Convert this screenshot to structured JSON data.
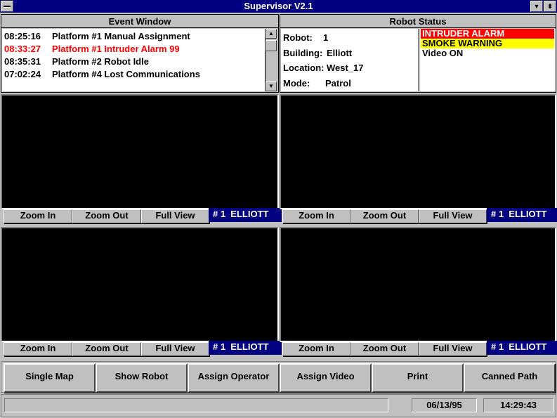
{
  "window": {
    "title": "Supervisor V2.1"
  },
  "event_window": {
    "title": "Event Window",
    "events": [
      {
        "time": "08:25:16",
        "text": "Platform #1 Manual Assignment",
        "color": "#000000"
      },
      {
        "time": "08:33:27",
        "text": "Platform #1 Intruder Alarm 99",
        "color": "#ff0000"
      },
      {
        "time": "08:35:31",
        "text": "Platform #2 Robot Idle",
        "color": "#000000"
      },
      {
        "time": "07:02:24",
        "text": "Platform #4  Lost Communications",
        "color": "#000000"
      }
    ]
  },
  "robot_status": {
    "title": "Robot Status",
    "robot_label": "Robot:",
    "robot_value": "1",
    "building_label": "Building:",
    "building_value": "Elliott",
    "location_label": "Location:",
    "location_value": "West_17",
    "mode_label": "Mode:",
    "mode_value": "Patrol",
    "alarms": [
      {
        "text": "INTRUDER ALARM",
        "bg": "#ff0000",
        "fg": "#ffffff"
      },
      {
        "text": "SMOKE WARNING",
        "bg": "#ffff00",
        "fg": "#000000"
      },
      {
        "text": "Video ON",
        "bg": "#ffffff",
        "fg": "#000000"
      }
    ]
  },
  "video_panels": [
    {
      "zoom_in": "Zoom In",
      "zoom_out": "Zoom Out",
      "full_view": "Full View",
      "label": "# 1  ELLIOTT"
    },
    {
      "zoom_in": "Zoom In",
      "zoom_out": "Zoom Out",
      "full_view": "Full View",
      "label": "# 1  ELLIOTT"
    },
    {
      "zoom_in": "Zoom In",
      "zoom_out": "Zoom Out",
      "full_view": "Full View",
      "label": "# 1  ELLIOTT"
    },
    {
      "zoom_in": "Zoom In",
      "zoom_out": "Zoom Out",
      "full_view": "Full View",
      "label": "# 1  ELLIOTT"
    }
  ],
  "toolbar": {
    "single_map": "Single Map",
    "show_robot": "Show Robot",
    "assign_operator": "Assign Operator",
    "assign_video": "Assign Video",
    "print": "Print",
    "canned_path": "Canned Path"
  },
  "status_bar": {
    "message": "",
    "date": "06/13/95",
    "time": "14:29:43"
  },
  "icons": {
    "system_menu": "system-menu-icon",
    "minimize": "down-arrow-icon",
    "maximize": "up-down-arrow-icon"
  },
  "colors": {
    "title_bar": "#000080",
    "face": "#c0c0c0",
    "video_bg": "#000000",
    "alarm_red": "#ff0000",
    "alarm_yellow": "#ffff00"
  }
}
